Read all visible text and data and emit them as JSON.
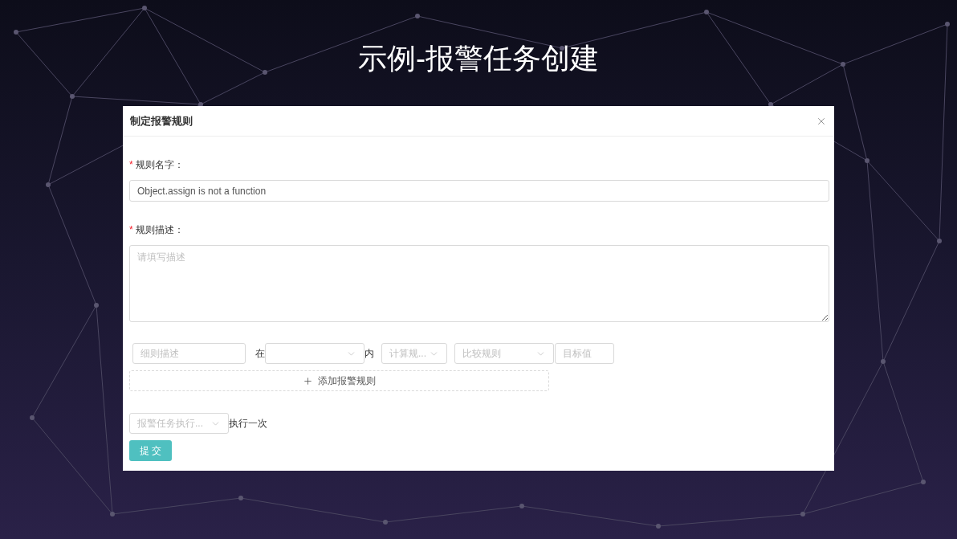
{
  "slide_title": "示例-报警任务创建",
  "dialog": {
    "title": "制定报警规则",
    "fields": [
      {
        "label": "规则名字：",
        "mark": "*",
        "kind": "input",
        "value": "Object.assign is not a function"
      },
      {
        "label": "规则描述：",
        "mark": "*",
        "kind": "textarea",
        "placeholder": "请填写描述"
      }
    ],
    "rule_row": [
      {
        "kind": "input",
        "placeholder": "细则描述"
      },
      {
        "kind": "text",
        "text": "在"
      },
      {
        "kind": "select"
      },
      {
        "kind": "text",
        "text": "内"
      },
      {
        "kind": "select",
        "placeholder": "计算规..."
      },
      {
        "kind": "select",
        "placeholder": "比较规则"
      },
      {
        "kind": "input",
        "placeholder": "目标值"
      }
    ],
    "add_button": "添加报警规则",
    "schedule": {
      "placeholder": "报警任务执行...",
      "suffix": "执行一次"
    },
    "submit": "提 交"
  }
}
